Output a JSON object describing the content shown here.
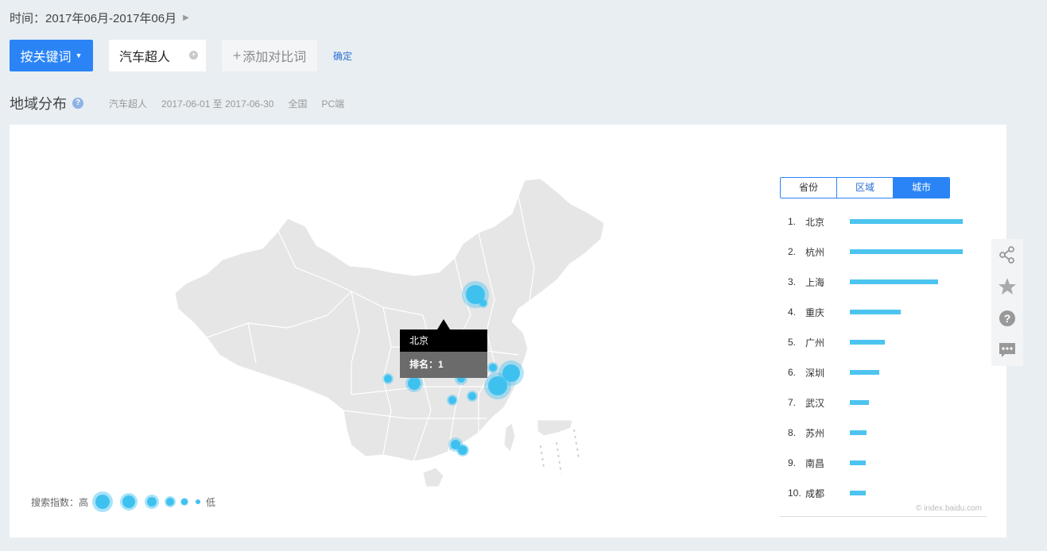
{
  "time": {
    "label": "时间：2017年06月-2017年06月"
  },
  "search": {
    "mode_button": "按关键词",
    "keyword": "汽车超人",
    "add_compare": "添加对比词",
    "confirm": "确定"
  },
  "section": {
    "title": "地域分布",
    "keyword": "汽车超人",
    "date_range": "2017-06-01 至 2017-06-30",
    "region": "全国",
    "device": "PC端"
  },
  "tooltip": {
    "title": "北京",
    "body": "排名：1"
  },
  "legend": {
    "label": "搜索指数：高",
    "low": "低"
  },
  "tabs": [
    {
      "label": "省份",
      "active": false
    },
    {
      "label": "区域",
      "active": false
    },
    {
      "label": "城市",
      "active": true
    }
  ],
  "ranking": [
    {
      "rank": "1.",
      "city": "北京",
      "share": 1.0
    },
    {
      "rank": "2.",
      "city": "杭州",
      "share": 1.0
    },
    {
      "rank": "3.",
      "city": "上海",
      "share": 0.78
    },
    {
      "rank": "4.",
      "city": "重庆",
      "share": 0.45
    },
    {
      "rank": "5.",
      "city": "广州",
      "share": 0.31
    },
    {
      "rank": "6.",
      "city": "深圳",
      "share": 0.26
    },
    {
      "rank": "7.",
      "city": "武汉",
      "share": 0.17
    },
    {
      "rank": "8.",
      "city": "苏州",
      "share": 0.15
    },
    {
      "rank": "9.",
      "city": "南昌",
      "share": 0.14
    },
    {
      "rank": "10.",
      "city": "成都",
      "share": 0.14
    }
  ],
  "copyright": "© index.baidu.com",
  "colors": {
    "accent": "#2a84f6",
    "bubble": "#3fc1f0",
    "bar": "#4dc4ef",
    "map_fill": "#e6e6e6"
  },
  "sidebar": [
    "share-icon",
    "star-icon",
    "help-icon",
    "comment-icon"
  ]
}
